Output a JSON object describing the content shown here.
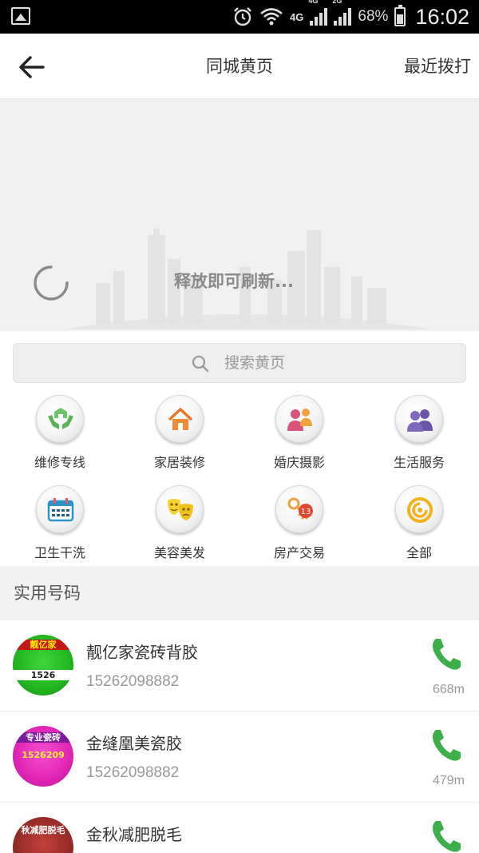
{
  "status_bar": {
    "network_a": "4G",
    "network_b": "4G",
    "network_c": "2G",
    "battery": "68%",
    "time": "16:02"
  },
  "header": {
    "title": "同城黄页",
    "recent_calls": "最近拨打"
  },
  "refresh": {
    "text": "释放即可刷新..."
  },
  "search": {
    "placeholder": "搜索黄页"
  },
  "categories": [
    {
      "label": "维修专线",
      "icon": "repair-hands-icon"
    },
    {
      "label": "家居装修",
      "icon": "house-icon"
    },
    {
      "label": "婚庆摄影",
      "icon": "couple-icon"
    },
    {
      "label": "生活服务",
      "icon": "people-icon"
    },
    {
      "label": "卫生干洗",
      "icon": "calendar-icon"
    },
    {
      "label": "美容美发",
      "icon": "masks-icon"
    },
    {
      "label": "房产交易",
      "icon": "keys-icon"
    },
    {
      "label": "全部",
      "icon": "spiral-icon"
    }
  ],
  "section": {
    "title": "实用号码"
  },
  "listings": [
    {
      "name": "靓亿家瓷砖背胶",
      "phone": "15262098882",
      "distance": "668m",
      "thumb_lines": [
        "靓亿家",
        "1526"
      ]
    },
    {
      "name": "金缝凰美瓷胶",
      "phone": "15262098882",
      "distance": "479m",
      "thumb_lines": [
        "专业瓷砖",
        "1526209"
      ]
    },
    {
      "name": "金秋减肥脱毛",
      "phone": "",
      "distance": "",
      "thumb_lines": [
        "秋减肥脱毛"
      ]
    }
  ],
  "colors": {
    "call_green": "#3cae4a",
    "header_bg": "#ffffff",
    "page_bg": "#f0f0f0"
  }
}
